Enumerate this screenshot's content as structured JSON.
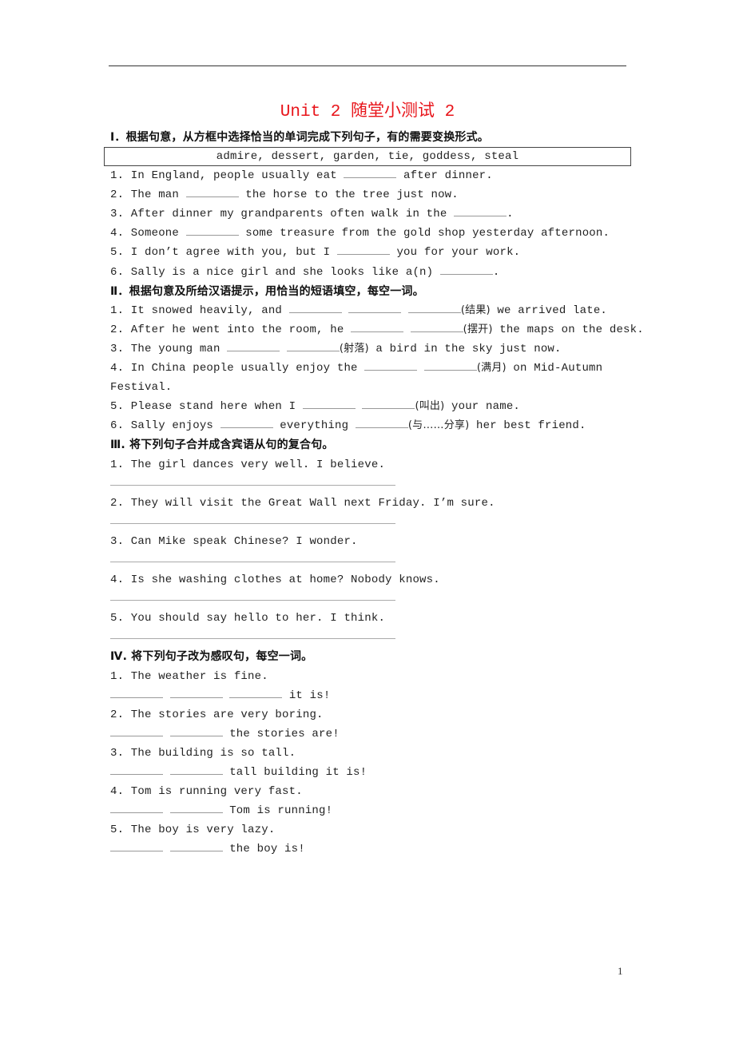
{
  "title": "Unit 2 随堂小测试 2",
  "sections": [
    {
      "heading": "Ⅰ．根据句意，从方框中选择恰当的单词完成下列句子，有的需要变换形式。",
      "word_box": "admire, dessert, garden, tie, goddess, steal",
      "items": [
        {
          "pre": "1. In England, people usually eat ",
          "blanks": 1,
          "post": " after dinner."
        },
        {
          "pre": "2. The man ",
          "blanks": 1,
          "post": " the horse to the tree just now."
        },
        {
          "pre": "3. After dinner my grandparents often walk in the ",
          "blanks": 1,
          "post": "."
        },
        {
          "pre": "4. Someone ",
          "blanks": 1,
          "post": " some treasure from the gold shop yesterday afternoon."
        },
        {
          "pre": "5. I don’t agree with you, but I ",
          "blanks": 1,
          "post": " you for your work."
        },
        {
          "pre": "6. Sally is a nice girl and she looks like a(n) ",
          "blanks": 1,
          "post": "."
        }
      ]
    },
    {
      "heading": "Ⅱ．根据句意及所给汉语提示，用恰当的短语填空，每空一词。",
      "items": [
        {
          "pre": "1. It snowed heavily, and ",
          "blanks": 3,
          "hint": "(结果)",
          "post": " we arrived late."
        },
        {
          "pre": "2. After he went into the room, he ",
          "blanks": 2,
          "hint": "(摆开)",
          "post": " the maps on the desk."
        },
        {
          "pre": "3. The young man ",
          "blanks": 2,
          "hint": "(射落)",
          "post": " a bird in the sky just now."
        },
        {
          "pre": "4. In China people usually enjoy the ",
          "blanks": 2,
          "hint": "(满月)",
          "post": " on Mid-Autumn",
          "continuation": "Festival."
        },
        {
          "pre": "5. Please stand here when I ",
          "blanks": 2,
          "hint": "(叫出)",
          "post": " your name."
        },
        {
          "pre": "6. Sally enjoys ",
          "blanks": 1,
          "mid": " everything ",
          "blanks2": 1,
          "hint": "(与……分享)",
          "post": " her best friend."
        }
      ]
    },
    {
      "heading": "Ⅲ. 将下列句子合并成含宾语从句的复合句。",
      "items": [
        {
          "text": "1. The girl dances very well. I believe."
        },
        {
          "text": "2. They will visit the Great Wall next Friday. I’m sure."
        },
        {
          "text": "3. Can Mike speak Chinese? I wonder."
        },
        {
          "text": "4. Is she washing clothes at home? Nobody knows."
        },
        {
          "text": "5. You should say hello to her. I think."
        }
      ]
    },
    {
      "heading": "Ⅳ. 将下列句子改为感叹句，每空一词。",
      "items": [
        {
          "text": "1. The weather is fine.",
          "blanks": 3,
          "answer_tail": " it is!"
        },
        {
          "text": "2. The stories are very boring.",
          "blanks": 2,
          "answer_tail": " the stories are!"
        },
        {
          "text": "3. The building is so tall.",
          "blanks": 2,
          "answer_tail": " tall building it is!"
        },
        {
          "text": "4. Tom is running very fast.",
          "blanks": 2,
          "answer_tail": " Tom is running!"
        },
        {
          "text": "5. The boy is very lazy.",
          "blanks": 2,
          "answer_tail": " the boy is!"
        }
      ]
    }
  ],
  "page_number": "1",
  "colors": {
    "title": "#e8141a"
  }
}
